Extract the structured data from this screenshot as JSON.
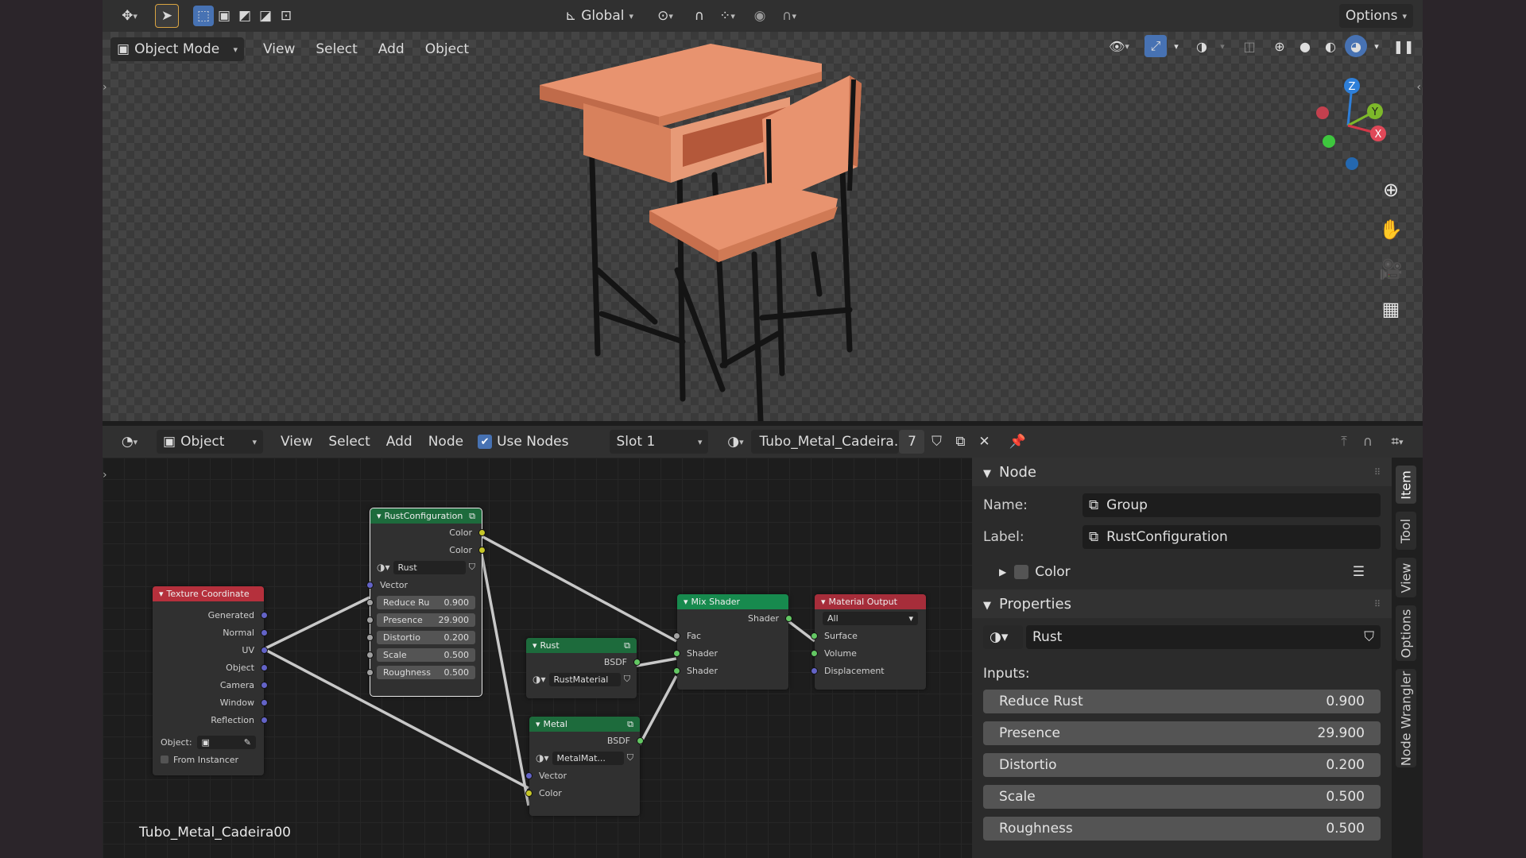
{
  "topbar": {
    "orientation": "Global",
    "options": "Options"
  },
  "viewport": {
    "mode": "Object Mode",
    "menus": [
      "View",
      "Select",
      "Add",
      "Object"
    ],
    "gizmo_axes": {
      "x": "X",
      "y": "Y",
      "z": "Z"
    }
  },
  "node_editor": {
    "object_mode": "Object",
    "menus": [
      "View",
      "Select",
      "Add",
      "Node"
    ],
    "use_nodes_label": "Use Nodes",
    "slot": "Slot 1",
    "material_name": "Tubo_Metal_Cadeira...",
    "user_count": "7",
    "object_name_label": "Tubo_Metal_Cadeira00"
  },
  "nodes": {
    "texcoord": {
      "title": "Texture Coordinate",
      "outputs": [
        "Generated",
        "Normal",
        "UV",
        "Object",
        "Camera",
        "Window",
        "Reflection"
      ],
      "object_label": "Object:",
      "from_instancer": "From Instancer"
    },
    "rustconfig": {
      "title": "RustConfiguration",
      "outputs": [
        "Color",
        "Color"
      ],
      "group_name": "Rust",
      "vector": "Vector",
      "fields": [
        {
          "label": "Reduce Ru",
          "value": "0.900"
        },
        {
          "label": "Presence",
          "value": "29.900"
        },
        {
          "label": "Distortio",
          "value": "0.200"
        },
        {
          "label": "Scale",
          "value": "0.500"
        },
        {
          "label": "Roughness",
          "value": "0.500"
        }
      ]
    },
    "rust": {
      "title": "Rust",
      "output": "BSDF",
      "group_name": "RustMaterial"
    },
    "metal": {
      "title": "Metal",
      "output": "BSDF",
      "group_name": "MetalMat...",
      "inputs": [
        "Vector",
        "Color"
      ]
    },
    "mix": {
      "title": "Mix Shader",
      "output": "Shader",
      "inputs": [
        "Fac",
        "Shader",
        "Shader"
      ]
    },
    "output": {
      "title": "Material Output",
      "target": "All",
      "inputs": [
        "Surface",
        "Volume",
        "Displacement"
      ]
    }
  },
  "side_panel": {
    "node_header": "Node",
    "name_label": "Name:",
    "name_value": "Group",
    "label_label": "Label:",
    "label_value": "RustConfiguration",
    "color_label": "Color",
    "properties_header": "Properties",
    "group_name": "Rust",
    "inputs_label": "Inputs:",
    "inputs": [
      {
        "label": "Reduce Rust",
        "value": "0.900"
      },
      {
        "label": "Presence",
        "value": "29.900"
      },
      {
        "label": "Distortio",
        "value": "0.200"
      },
      {
        "label": "Scale",
        "value": "0.500"
      },
      {
        "label": "Roughness",
        "value": "0.500"
      }
    ],
    "tabs": [
      "Item",
      "Tool",
      "View",
      "Options",
      "Node Wrangler"
    ]
  },
  "colors": {
    "accent": "#4772b3",
    "texcoord_header": "#b5303c",
    "group_header": "#1d6b3c",
    "shader_header": "#178a4e",
    "output_header": "#a62d3a",
    "socket_vector": "#6363c7",
    "socket_color": "#c7c729",
    "socket_shader": "#63c763"
  }
}
